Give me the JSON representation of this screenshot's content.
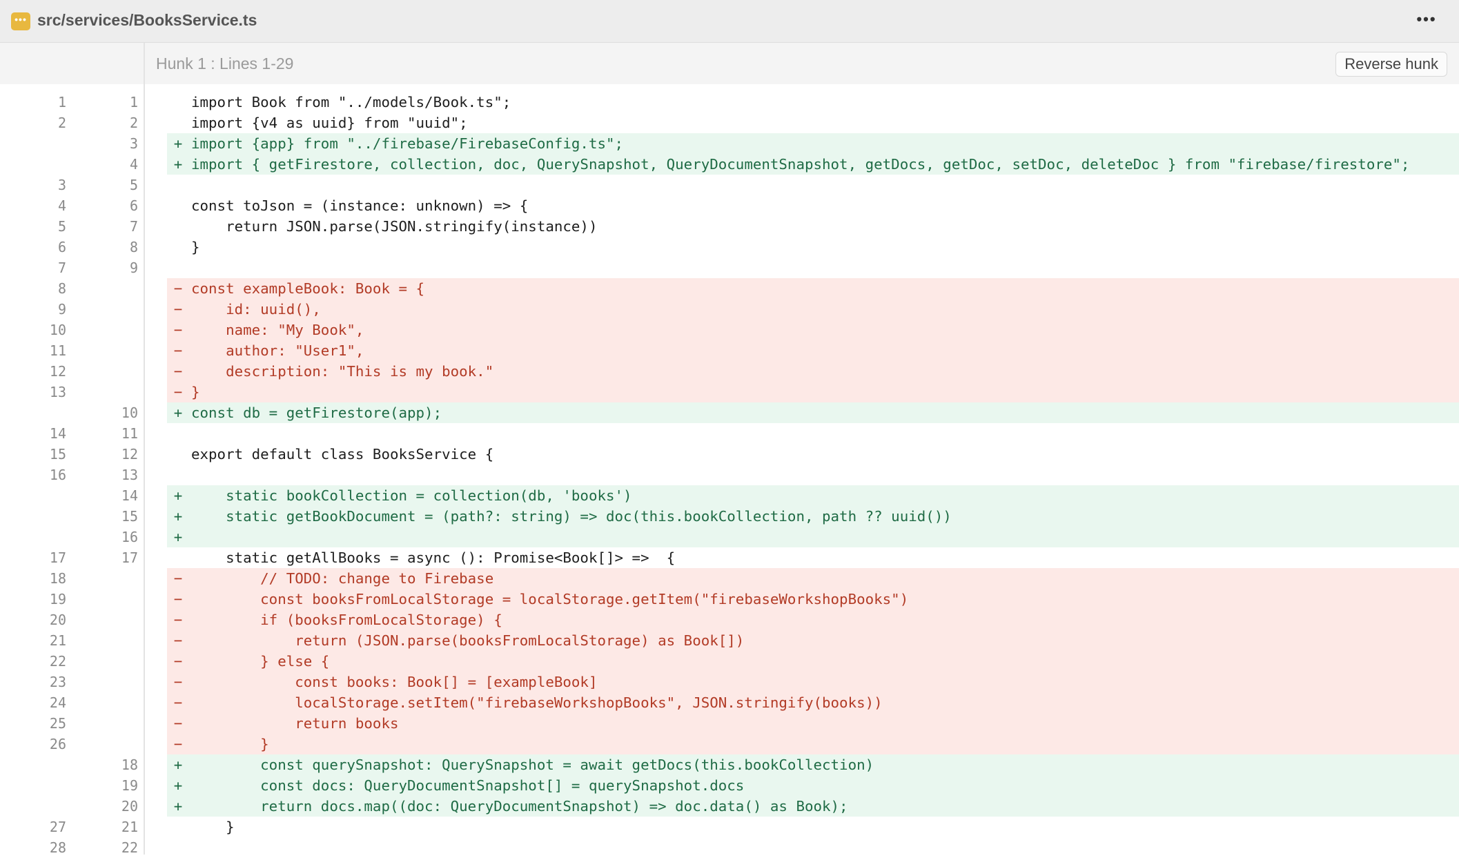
{
  "file": {
    "icon": "file-options-icon",
    "icon_glyph": "•••",
    "path": "src/services/BooksService.ts",
    "more_glyph": "•••"
  },
  "hunk": {
    "label": "Hunk 1 : Lines 1-29",
    "reverse_label": "Reverse hunk"
  },
  "colors": {
    "added_bg": "#e9f7ef",
    "added_text": "#1f6b45",
    "removed_bg": "#fde9e6",
    "removed_text": "#b23b26",
    "file_icon": "#e8b83f"
  },
  "lines": [
    {
      "old": "1",
      "new": "1",
      "type": "context",
      "sign": "",
      "code": "import Book from \"../models/Book.ts\";"
    },
    {
      "old": "2",
      "new": "2",
      "type": "context",
      "sign": "",
      "code": "import {v4 as uuid} from \"uuid\";"
    },
    {
      "old": "",
      "new": "3",
      "type": "add",
      "sign": "+",
      "code": "import {app} from \"../firebase/FirebaseConfig.ts\";"
    },
    {
      "old": "",
      "new": "4",
      "type": "add",
      "sign": "+",
      "code": "import { getFirestore, collection, doc, QuerySnapshot, QueryDocumentSnapshot, getDocs, getDoc, setDoc, deleteDoc } from \"firebase/firestore\";"
    },
    {
      "old": "3",
      "new": "5",
      "type": "context",
      "sign": "",
      "code": ""
    },
    {
      "old": "4",
      "new": "6",
      "type": "context",
      "sign": "",
      "code": "const toJson = (instance: unknown) => {"
    },
    {
      "old": "5",
      "new": "7",
      "type": "context",
      "sign": "",
      "code": "    return JSON.parse(JSON.stringify(instance))"
    },
    {
      "old": "6",
      "new": "8",
      "type": "context",
      "sign": "",
      "code": "}"
    },
    {
      "old": "7",
      "new": "9",
      "type": "context",
      "sign": "",
      "code": ""
    },
    {
      "old": "8",
      "new": "",
      "type": "del",
      "sign": "−",
      "code": "const exampleBook: Book = {"
    },
    {
      "old": "9",
      "new": "",
      "type": "del",
      "sign": "−",
      "code": "    id: uuid(),"
    },
    {
      "old": "10",
      "new": "",
      "type": "del",
      "sign": "−",
      "code": "    name: \"My Book\","
    },
    {
      "old": "11",
      "new": "",
      "type": "del",
      "sign": "−",
      "code": "    author: \"User1\","
    },
    {
      "old": "12",
      "new": "",
      "type": "del",
      "sign": "−",
      "code": "    description: \"This is my book.\""
    },
    {
      "old": "13",
      "new": "",
      "type": "del",
      "sign": "−",
      "code": "}"
    },
    {
      "old": "",
      "new": "10",
      "type": "add",
      "sign": "+",
      "code": "const db = getFirestore(app);"
    },
    {
      "old": "14",
      "new": "11",
      "type": "context",
      "sign": "",
      "code": ""
    },
    {
      "old": "15",
      "new": "12",
      "type": "context",
      "sign": "",
      "code": "export default class BooksService {"
    },
    {
      "old": "16",
      "new": "13",
      "type": "context",
      "sign": "",
      "code": ""
    },
    {
      "old": "",
      "new": "14",
      "type": "add",
      "sign": "+",
      "code": "    static bookCollection = collection(db, 'books')"
    },
    {
      "old": "",
      "new": "15",
      "type": "add",
      "sign": "+",
      "code": "    static getBookDocument = (path?: string) => doc(this.bookCollection, path ?? uuid())"
    },
    {
      "old": "",
      "new": "16",
      "type": "add",
      "sign": "+",
      "code": ""
    },
    {
      "old": "17",
      "new": "17",
      "type": "context",
      "sign": "",
      "code": "    static getAllBooks = async (): Promise<Book[]> =>  {"
    },
    {
      "old": "18",
      "new": "",
      "type": "del",
      "sign": "−",
      "code": "        // TODO: change to Firebase"
    },
    {
      "old": "19",
      "new": "",
      "type": "del",
      "sign": "−",
      "code": "        const booksFromLocalStorage = localStorage.getItem(\"firebaseWorkshopBooks\")"
    },
    {
      "old": "20",
      "new": "",
      "type": "del",
      "sign": "−",
      "code": "        if (booksFromLocalStorage) {"
    },
    {
      "old": "21",
      "new": "",
      "type": "del",
      "sign": "−",
      "code": "            return (JSON.parse(booksFromLocalStorage) as Book[])"
    },
    {
      "old": "22",
      "new": "",
      "type": "del",
      "sign": "−",
      "code": "        } else {"
    },
    {
      "old": "23",
      "new": "",
      "type": "del",
      "sign": "−",
      "code": "            const books: Book[] = [exampleBook]"
    },
    {
      "old": "24",
      "new": "",
      "type": "del",
      "sign": "−",
      "code": "            localStorage.setItem(\"firebaseWorkshopBooks\", JSON.stringify(books))"
    },
    {
      "old": "25",
      "new": "",
      "type": "del",
      "sign": "−",
      "code": "            return books"
    },
    {
      "old": "26",
      "new": "",
      "type": "del",
      "sign": "−",
      "code": "        }"
    },
    {
      "old": "",
      "new": "18",
      "type": "add",
      "sign": "+",
      "code": "        const querySnapshot: QuerySnapshot = await getDocs(this.bookCollection)"
    },
    {
      "old": "",
      "new": "19",
      "type": "add",
      "sign": "+",
      "code": "        const docs: QueryDocumentSnapshot[] = querySnapshot.docs"
    },
    {
      "old": "",
      "new": "20",
      "type": "add",
      "sign": "+",
      "code": "        return docs.map((doc: QueryDocumentSnapshot) => doc.data() as Book);"
    },
    {
      "old": "27",
      "new": "21",
      "type": "context",
      "sign": "",
      "code": "    }"
    },
    {
      "old": "28",
      "new": "22",
      "type": "context",
      "sign": "",
      "code": ""
    }
  ]
}
